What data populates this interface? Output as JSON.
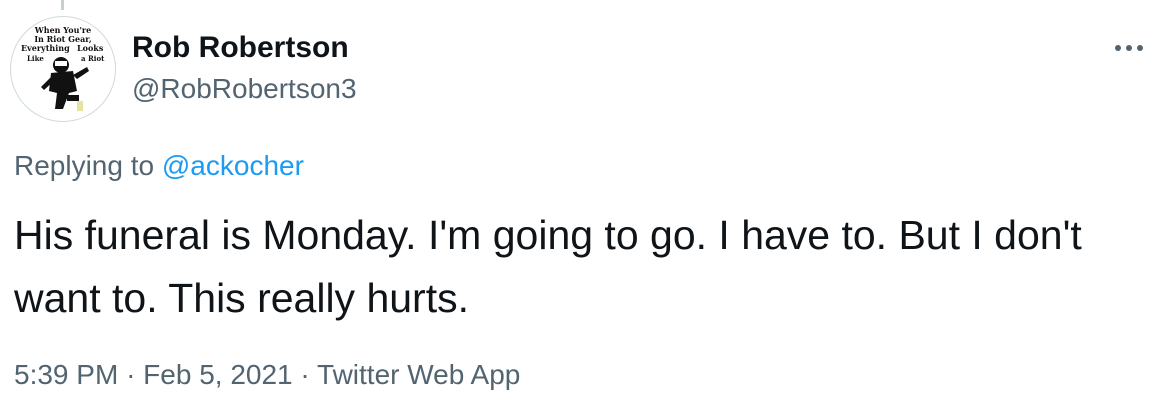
{
  "tweet": {
    "author": {
      "display_name": "Rob Robertson",
      "handle": "@RobRobertson3",
      "avatar_text": "When You're In Riot Gear, Everything Looks Like a Riot"
    },
    "replying_to": {
      "prefix": "Replying to",
      "mention": "@ackocher"
    },
    "text": "His funeral is Monday. I'm going to go. I have to. But I don't want to. This really hurts.",
    "meta": {
      "time": "5:39 PM",
      "separator": "·",
      "date": "Feb 5, 2021",
      "source": "Twitter Web App"
    },
    "more_icon": "more-horizontal-icon"
  },
  "colors": {
    "text_primary": "#0f1419",
    "text_secondary": "#536471",
    "link": "#1d9bf0"
  }
}
